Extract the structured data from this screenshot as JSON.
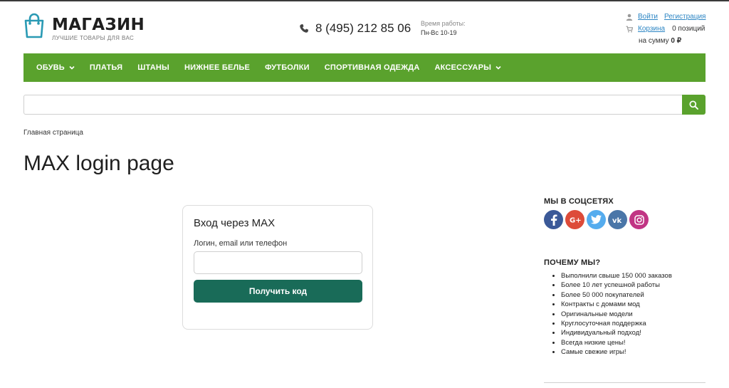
{
  "header": {
    "logo_title": "МАГАЗИН",
    "logo_subtitle": "ЛУЧШИЕ ТОВАРЫ ДЛЯ ВАС",
    "phone": "8 (495) 212 85 06",
    "hours_label": "Время работы:",
    "hours_value": "Пн-Вс 10-19",
    "login_link": "Войти",
    "register_link": "Регистрация",
    "cart_link": "Корзина",
    "cart_count": "0 позиций",
    "cart_sum_prefix": "на сумму",
    "cart_sum_value": "0 ₽"
  },
  "nav": {
    "items": [
      {
        "label": "ОБУВЬ",
        "dropdown": true
      },
      {
        "label": "ПЛАТЬЯ",
        "dropdown": false
      },
      {
        "label": "ШТАНЫ",
        "dropdown": false
      },
      {
        "label": "НИЖНЕЕ БЕЛЬЕ",
        "dropdown": false
      },
      {
        "label": "ФУТБОЛКИ",
        "dropdown": false
      },
      {
        "label": "СПОРТИВНАЯ ОДЕЖДА",
        "dropdown": false
      },
      {
        "label": "АКСЕССУАРЫ",
        "dropdown": true
      }
    ]
  },
  "search": {
    "value": "",
    "placeholder": ""
  },
  "breadcrumb": "Главная страница",
  "page_title": "MAX login page",
  "login_card": {
    "title": "Вход через MAX",
    "field_label": "Логин, email или телефон",
    "field_value": "",
    "submit_label": "Получить код"
  },
  "sidebar": {
    "social_title": "МЫ В СОЦСЕТЯХ",
    "social_icons": [
      "facebook-icon",
      "google-plus-icon",
      "twitter-icon",
      "vk-icon",
      "instagram-icon"
    ],
    "why_title": "ПОЧЕМУ МЫ?",
    "why_items": [
      "Выполнили свыше 150 000 заказов",
      "Более 10 лет успешной работы",
      "Более 50 000 покупателей",
      "Контракты с домами мод",
      "Оригинальные модели",
      "Круглосуточная поддержка",
      "Индивидуальный подход!",
      "Всегда низкие цены!",
      "Самые свежие игры!"
    ]
  },
  "colors": {
    "brand_green": "#5aa22d",
    "button_dark_green": "#196b58",
    "logo_teal": "#2a9ab4",
    "link_blue": "#2d86c4"
  }
}
